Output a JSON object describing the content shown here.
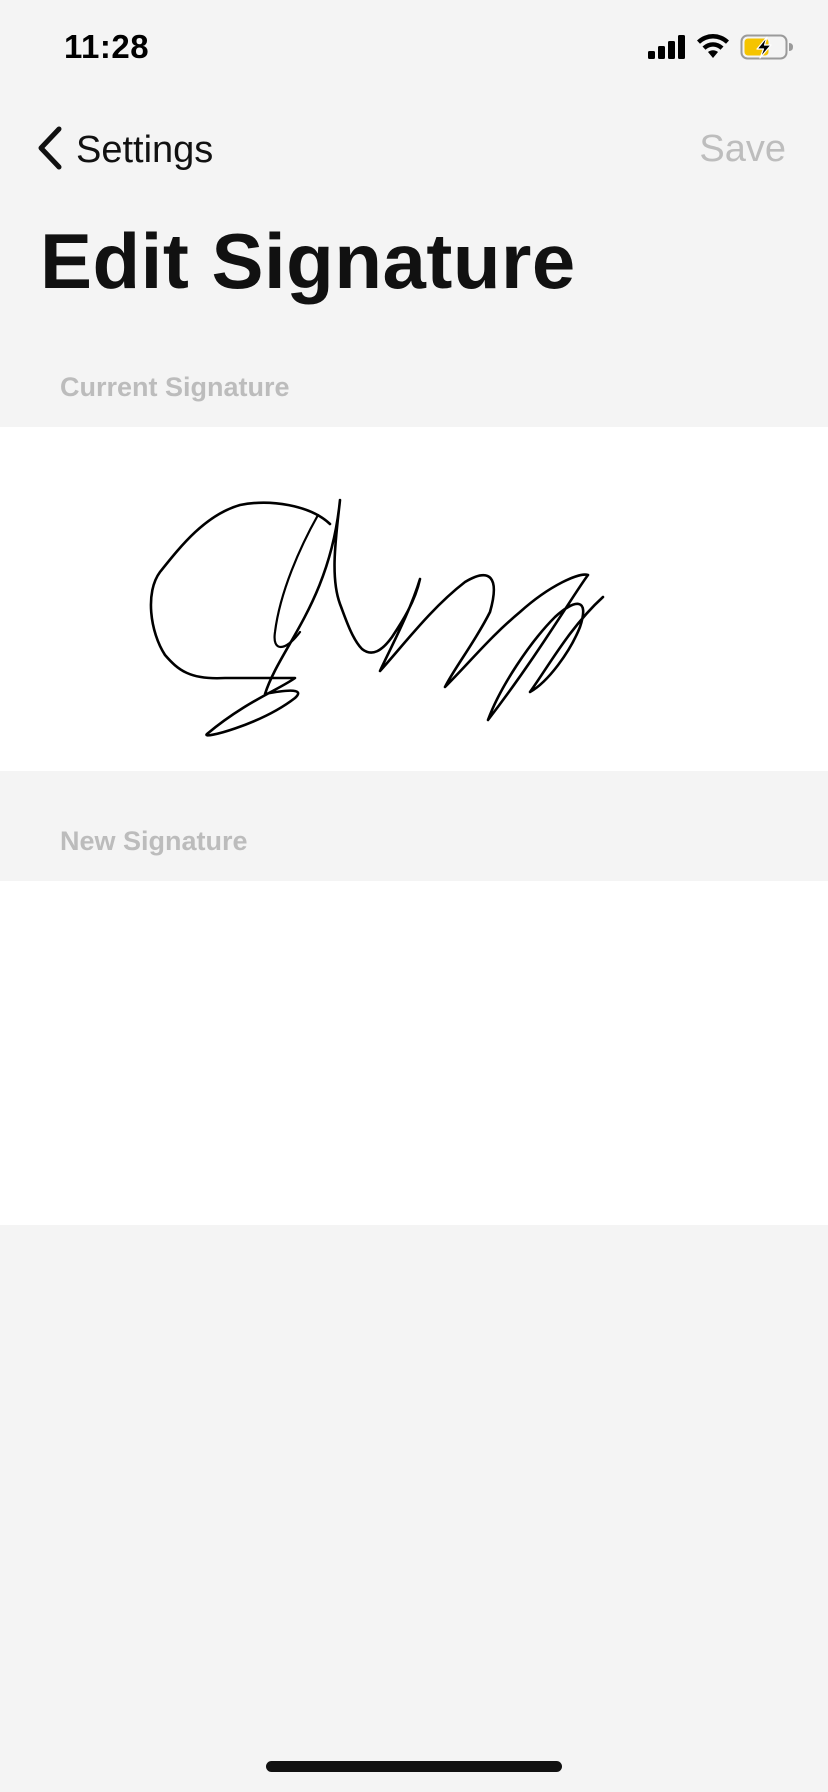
{
  "status_bar": {
    "time": "11:28",
    "icons": [
      "cellular-signal-icon",
      "wifi-icon",
      "battery-charging-icon"
    ],
    "battery_color": "#f5c400"
  },
  "nav": {
    "back_label": "Settings",
    "back_icon": "chevron-left-icon",
    "save_label": "Save",
    "save_color": "#bdbdbd"
  },
  "page": {
    "title": "Edit Signature"
  },
  "sections": {
    "current": {
      "header": "Current Signature"
    },
    "new": {
      "header": "New Signature"
    }
  },
  "colors": {
    "background": "#f4f4f4",
    "panel": "#ffffff",
    "section_header": "#bcbcbc",
    "text": "#111111"
  }
}
